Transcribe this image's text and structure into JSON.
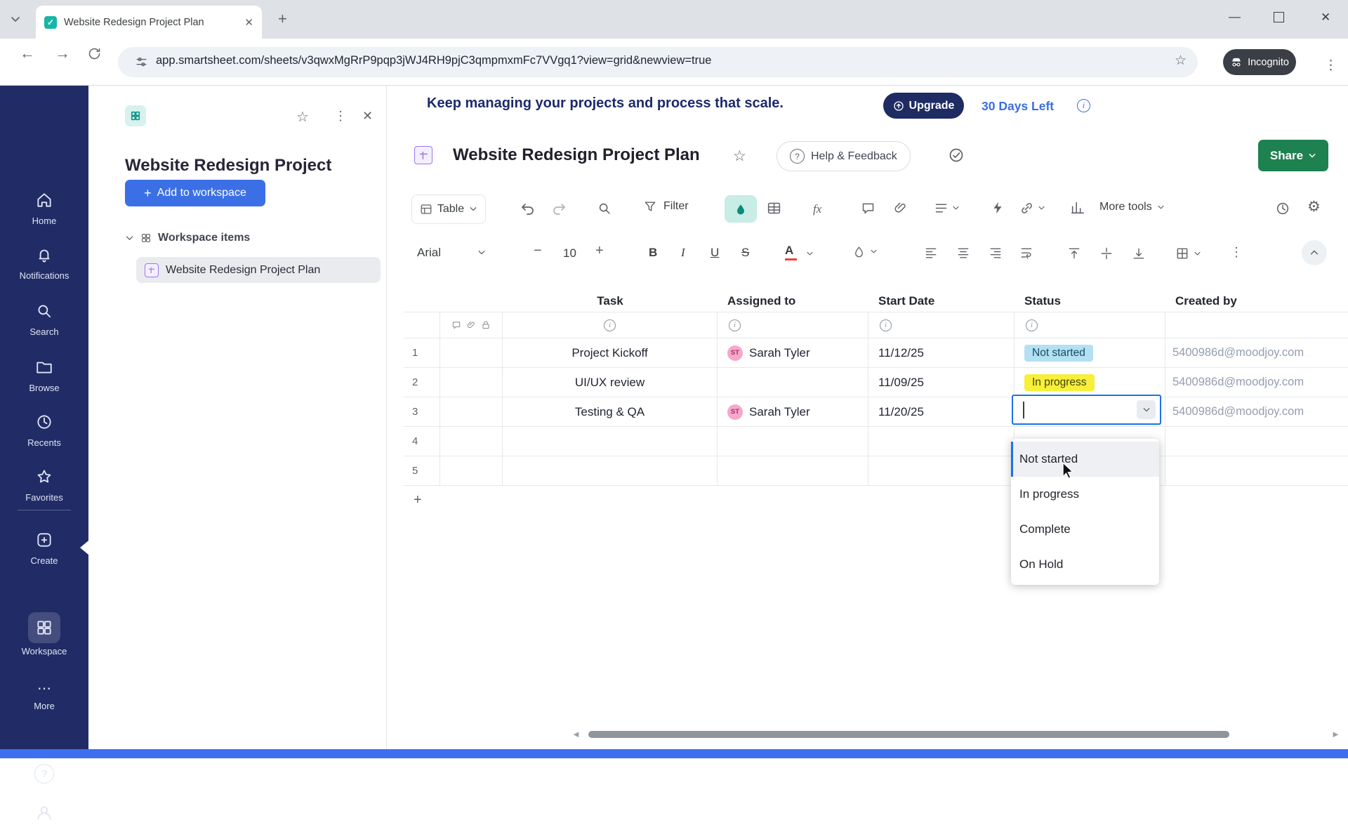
{
  "browser": {
    "tab_title": "Website Redesign Project Plan",
    "url": "app.smartsheet.com/sheets/v3qwxMgRrP9pqp3jWJ4RH9pjC3qmpmxmFc7VVgq1?view=grid&newview=true",
    "incognito_label": "Incognito"
  },
  "sidebar": {
    "items": [
      {
        "label": "Home"
      },
      {
        "label": "Notifications"
      },
      {
        "label": "Search"
      },
      {
        "label": "Browse"
      },
      {
        "label": "Recents"
      },
      {
        "label": "Favorites"
      },
      {
        "label": "Create"
      },
      {
        "label": "Workspace"
      },
      {
        "label": "More"
      }
    ]
  },
  "panel": {
    "title": "Website Redesign Project",
    "add_to_workspace_label": "Add to workspace",
    "section_label": "Workspace items",
    "item_label": "Website Redesign Project Plan"
  },
  "banner": {
    "message": "Keep managing your projects and process that scale.",
    "upgrade_label": "Upgrade",
    "days_left_label": "30 Days Left"
  },
  "sheet": {
    "title": "Website Redesign Project Plan",
    "help_feedback_label": "Help & Feedback",
    "share_label": "Share"
  },
  "toolbar": {
    "table_label": "Table",
    "filter_label": "Filter",
    "more_tools_label": "More tools"
  },
  "format_bar": {
    "font_name": "Arial",
    "font_size": "10"
  },
  "grid": {
    "columns": [
      "Task",
      "Assigned to",
      "Start Date",
      "Status",
      "Created by"
    ],
    "rows": [
      {
        "num": "1",
        "task": "Project Kickoff",
        "assignee": "Sarah Tyler",
        "initials": "ST",
        "start_date": "11/12/25",
        "status": "Not started",
        "created_by": "5400986d@moodjoy.com"
      },
      {
        "num": "2",
        "task": "UI/UX review",
        "assignee": "",
        "initials": "",
        "start_date": "11/09/25",
        "status": "In progress",
        "created_by": "5400986d@moodjoy.com"
      },
      {
        "num": "3",
        "task": "Testing & QA",
        "assignee": "Sarah Tyler",
        "initials": "ST",
        "start_date": "11/20/25",
        "status": "",
        "created_by": "5400986d@moodjoy.com"
      },
      {
        "num": "4"
      },
      {
        "num": "5"
      }
    ]
  },
  "status_dropdown": {
    "options": [
      "Not started",
      "In progress",
      "Complete",
      "On Hold"
    ]
  },
  "colors": {
    "sidebar_bg": "#212c66",
    "accent_blue": "#3b6fe5",
    "share_green": "#1e8150",
    "selection_blue": "#1a73e8",
    "status_not_started_bg": "#b3e0f2",
    "status_in_progress_bg": "#f7ef3a",
    "banner_navy": "#1f2b63"
  }
}
